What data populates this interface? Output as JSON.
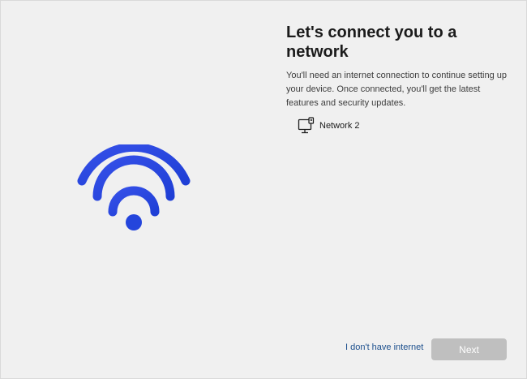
{
  "page": {
    "title": "Let's connect you to a network",
    "description": "You'll need an internet connection to continue setting up your device. Once connected, you'll get the latest features and security updates."
  },
  "illustration": {
    "icon": "wifi-icon",
    "color": "#2a47e0"
  },
  "networks": [
    {
      "name": "Network 2",
      "icon": "wired-ethernet-icon"
    }
  ],
  "footer": {
    "no_internet_label": "I don't have internet",
    "next_label": "Next",
    "link_color": "#1a4e8c",
    "next_disabled": true
  }
}
